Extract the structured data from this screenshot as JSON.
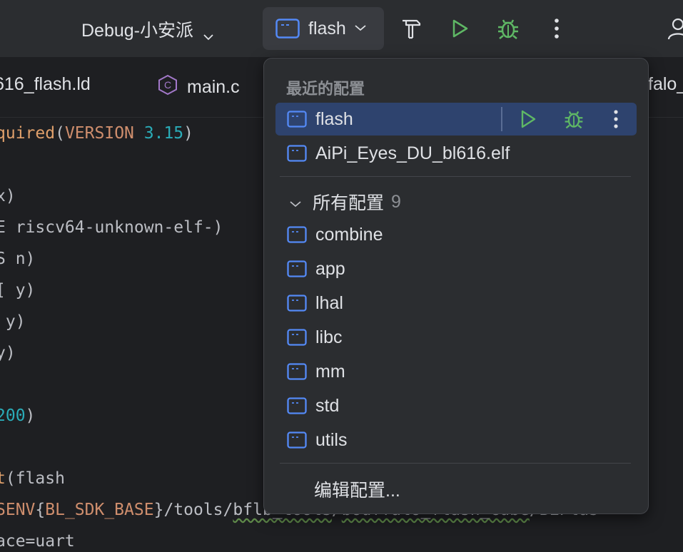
{
  "toolbar": {
    "profile_label": "Debug-小安派",
    "config_label": "flash",
    "icons": [
      "build-hammer-icon",
      "run-icon",
      "debug-icon",
      "more-vertical-icon",
      "account-icon"
    ]
  },
  "tabs": [
    {
      "label": "616_flash.ld"
    },
    {
      "label": "main.c",
      "badge": "C"
    },
    {
      "label": "falo_"
    }
  ],
  "code_lines": [
    {
      "parts": [
        {
          "t": "quired",
          "c": "kw-fn"
        },
        {
          "t": "(",
          "c": "plain"
        },
        {
          "t": "VERSION",
          "c": "kw-orange"
        },
        {
          "t": " ",
          "c": "plain"
        },
        {
          "t": "3.15",
          "c": "num"
        },
        {
          "t": ")",
          "c": "plain"
        }
      ]
    },
    {
      "parts": []
    },
    {
      "parts": [
        {
          "t": "x)",
          "c": "plain"
        }
      ]
    },
    {
      "parts": [
        {
          "t": "E riscv64-unknown-elf-)",
          "c": "plain"
        }
      ]
    },
    {
      "parts": [
        {
          "t": "S n)",
          "c": "plain"
        }
      ]
    },
    {
      "parts": [
        {
          "t": "[ y)",
          "c": "plain"
        }
      ]
    },
    {
      "parts": [
        {
          "t": " y)",
          "c": "plain"
        }
      ]
    },
    {
      "parts": [
        {
          "t": "y)",
          "c": "plain"
        }
      ]
    },
    {
      "parts": []
    },
    {
      "parts": [
        {
          "t": "200",
          "c": "num"
        },
        {
          "t": ")",
          "c": "plain"
        }
      ]
    },
    {
      "parts": []
    },
    {
      "parts": [
        {
          "t": "t",
          "c": "kw-fn"
        },
        {
          "t": "(flash",
          "c": "plain"
        }
      ]
    },
    {
      "parts": [
        {
          "t": "SENV",
          "c": "kw-orange"
        },
        {
          "t": "{",
          "c": "plain"
        },
        {
          "t": "BL_SDK_BASE",
          "c": "kw-orange"
        },
        {
          "t": "}",
          "c": "plain"
        },
        {
          "t": "/tools/",
          "c": "plain"
        },
        {
          "t": "bflb_tools",
          "c": "plain squig"
        },
        {
          "t": "/",
          "c": "plain"
        },
        {
          "t": "bouffalo_flash_cube",
          "c": "plain squig"
        },
        {
          "t": "/BLFlas",
          "c": "plain"
        }
      ]
    },
    {
      "parts": [
        {
          "t": "ace=uart",
          "c": "plain"
        }
      ]
    }
  ],
  "popup": {
    "recent_title": "最近的配置",
    "recent": [
      {
        "label": "flash",
        "selected": true
      },
      {
        "label": "AiPi_Eyes_DU_bl616.elf",
        "selected": false
      }
    ],
    "all_title": "所有配置",
    "all_count": "9",
    "all": [
      {
        "label": "combine"
      },
      {
        "label": "app"
      },
      {
        "label": "lhal"
      },
      {
        "label": "libc"
      },
      {
        "label": "mm"
      },
      {
        "label": "std"
      },
      {
        "label": "utils"
      }
    ],
    "edit_label": "编辑配置..."
  },
  "colors": {
    "accent_blue": "#3574f0",
    "run_green": "#5fb865",
    "selection": "#2e436e",
    "popup_bg": "#2b2d30"
  }
}
